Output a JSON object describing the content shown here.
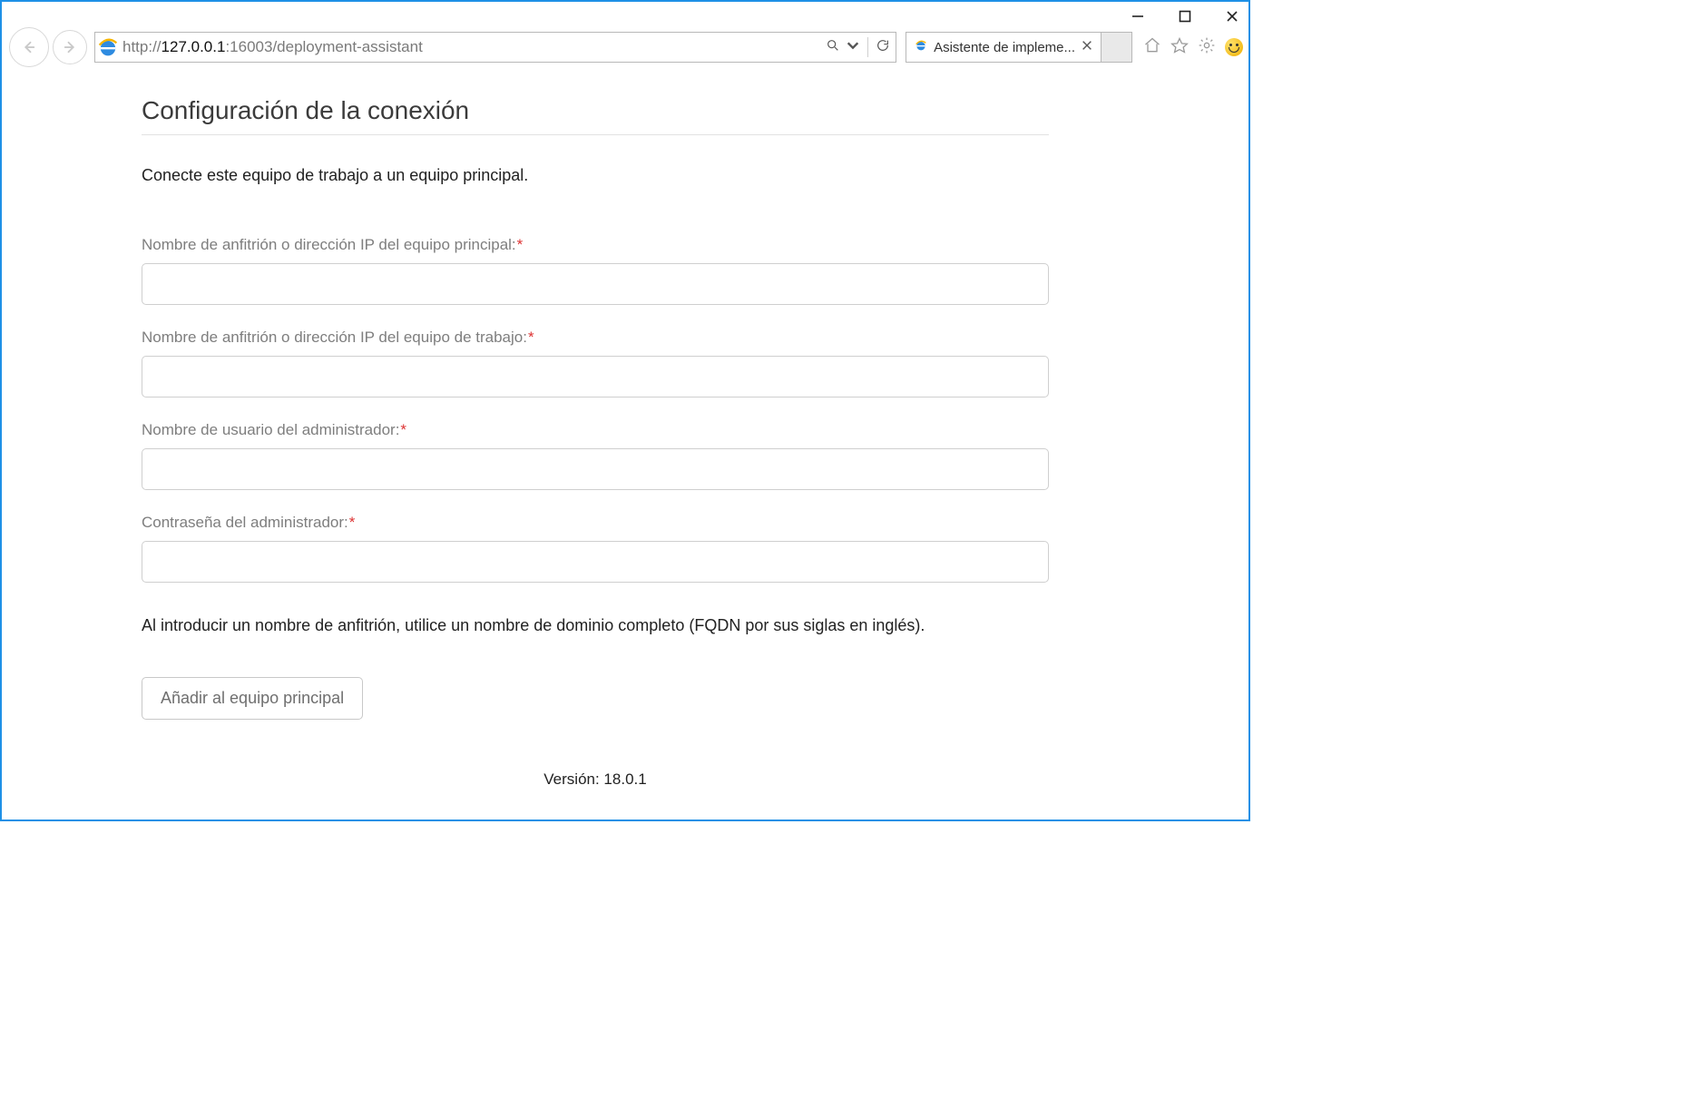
{
  "browser": {
    "url_scheme": "http://",
    "url_host": "127.0.0.1",
    "url_port": ":16003",
    "url_path": "/deployment-assistant",
    "tab_title": "Asistente de impleme..."
  },
  "page": {
    "title": "Configuración de la conexión",
    "intro": "Conecte este equipo de trabajo a un equipo principal.",
    "fields": {
      "primary_host": {
        "label": "Nombre de anfitrión o dirección IP del equipo principal:",
        "value": ""
      },
      "work_host": {
        "label": "Nombre de anfitrión o dirección IP del equipo de trabajo:",
        "value": ""
      },
      "admin_user": {
        "label": "Nombre de usuario del administrador:",
        "value": ""
      },
      "admin_pass": {
        "label": "Contraseña del administrador:",
        "value": ""
      }
    },
    "required_mark": "*",
    "helper": "Al introducir un nombre de anfitrión, utilice un nombre de dominio completo (FQDN por sus siglas en inglés).",
    "submit_label": "Añadir al equipo principal",
    "version_label": "Versión: 18.0.1"
  }
}
